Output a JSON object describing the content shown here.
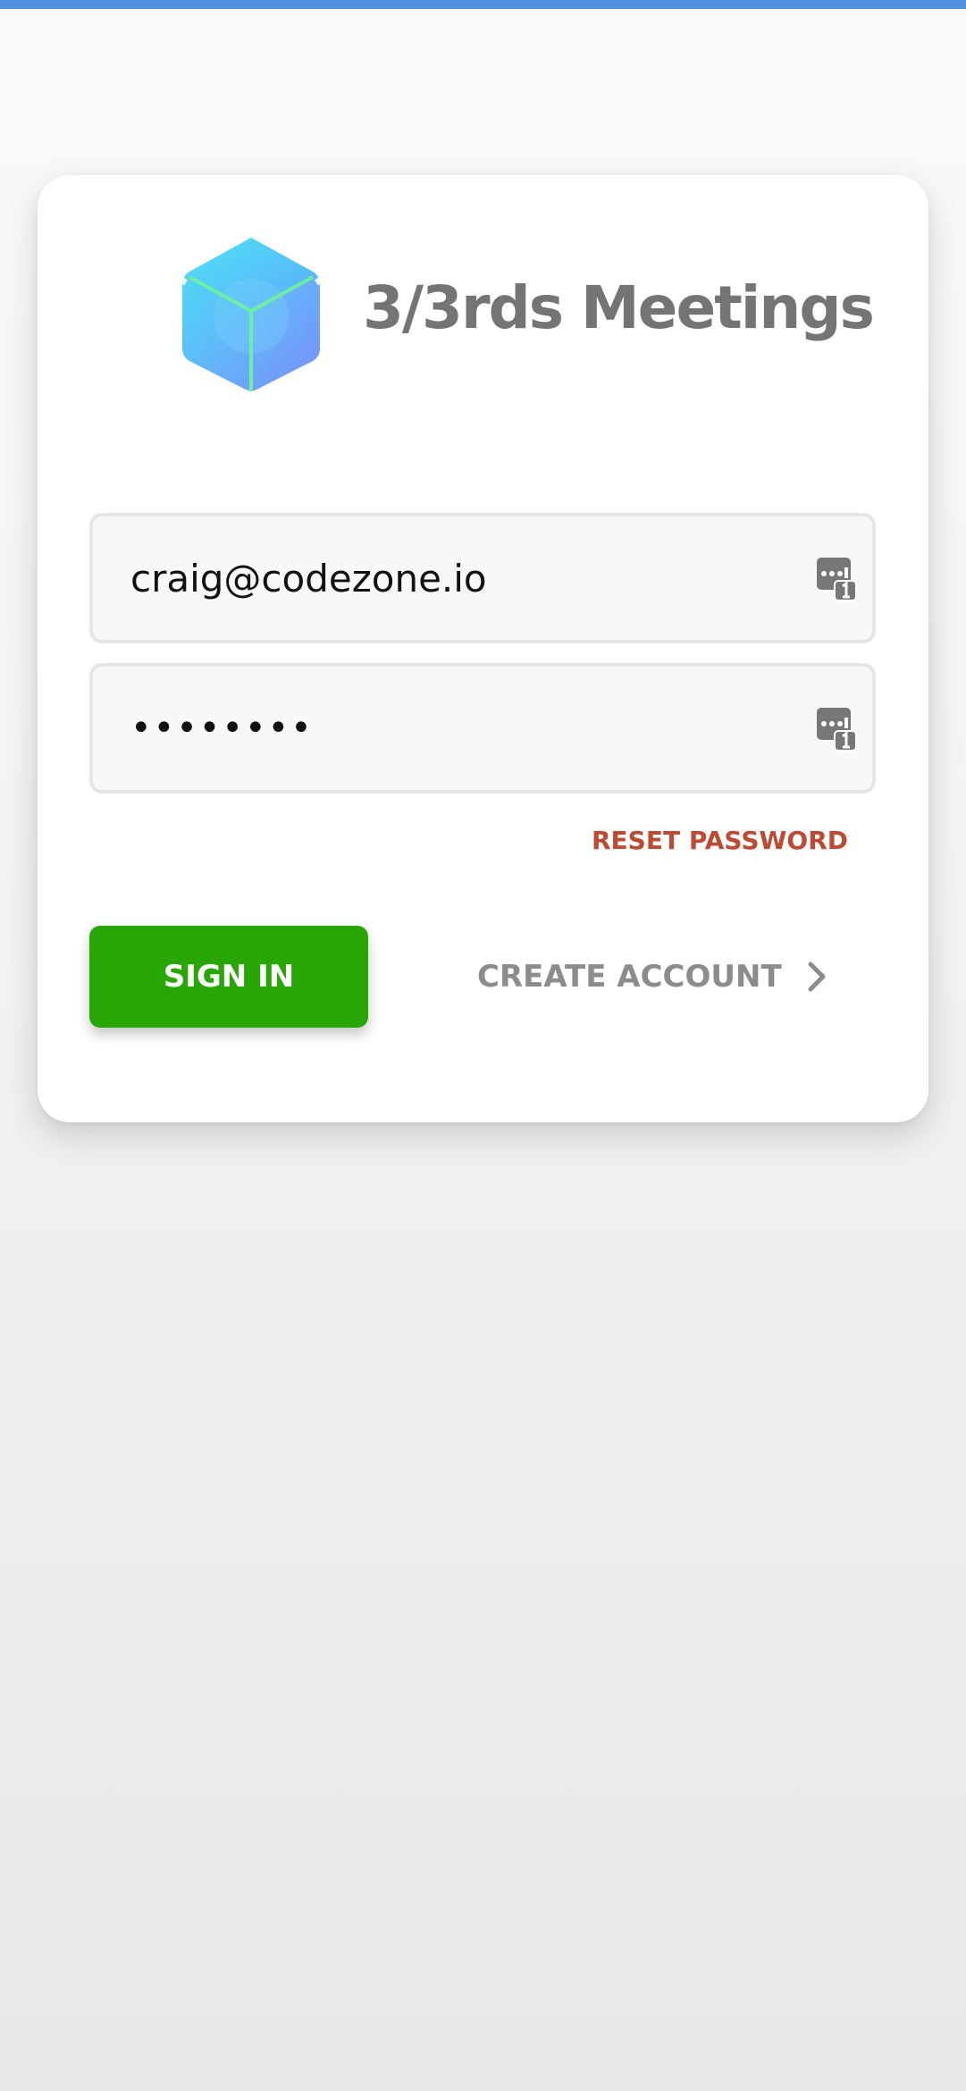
{
  "app": {
    "title": "3/3rds Meetings",
    "logo_icon": "cube-logo-icon"
  },
  "form": {
    "email_value": "craig@codezone.io",
    "password_value": "••••••••",
    "password_manager_icon": "password-manager-icon"
  },
  "actions": {
    "reset_password_label": "RESET PASSWORD",
    "sign_in_label": "SIGN IN",
    "create_account_label": "CREATE ACCOUNT",
    "create_account_icon": "chevron-right-icon"
  },
  "colors": {
    "top_bar": "#5090de",
    "sign_in_button": "#28a603",
    "reset_link": "#bd4a32",
    "title_text": "#747474",
    "create_account_text": "#8c8c8c"
  }
}
